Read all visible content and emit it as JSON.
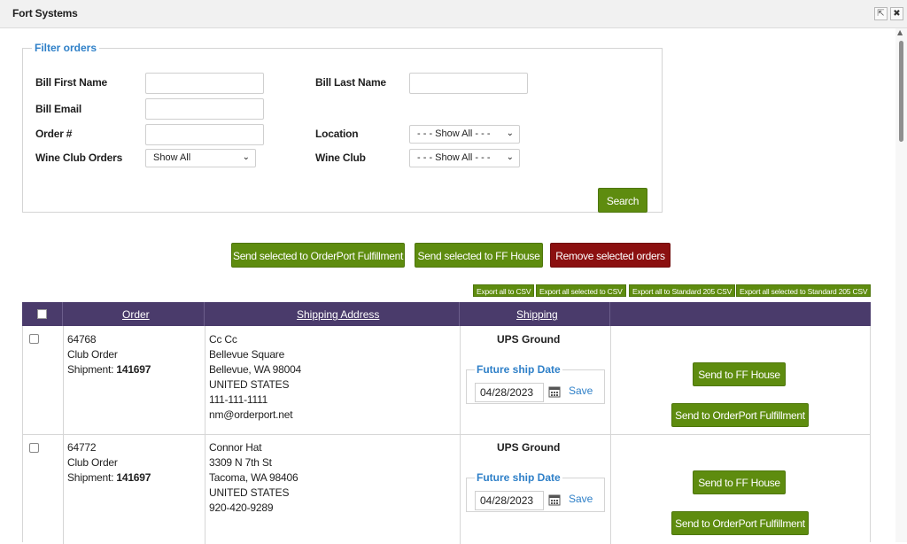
{
  "window": {
    "title": "Fort Systems",
    "popout_icon": "⇱",
    "close_icon": "✖"
  },
  "filter": {
    "legend": "Filter orders",
    "bill_first_name_label": "Bill First Name",
    "bill_last_name_label": "Bill Last Name",
    "bill_email_label": "Bill Email",
    "order_label": "Order #",
    "location_label": "Location",
    "location_value": "- - - Show All - - -",
    "wine_club_orders_label": "Wine Club Orders",
    "wine_club_orders_value": "Show All",
    "wine_club_label": "Wine Club",
    "wine_club_value": "- - - Show All - - -",
    "search_label": "Search"
  },
  "actions": {
    "send_orderport": "Send selected to OrderPort Fulfillment",
    "send_ff_house": "Send selected to FF House",
    "remove": "Remove selected orders"
  },
  "exports": [
    "Export all to CSV",
    "Export all selected to CSV",
    "Export all to Standard 205 CSV",
    "Export all selected to Standard 205 CSV"
  ],
  "table": {
    "headers": {
      "order": "Order",
      "address": "Shipping Address",
      "shipping": "Shipping"
    },
    "rows": [
      {
        "order_no": "64768",
        "order_type": "Club Order",
        "shipment_label": "Shipment: ",
        "shipment_no": "141697",
        "address": [
          "Cc Cc",
          "Bellevue Square",
          "Bellevue, WA 98004",
          "UNITED STATES",
          "111-111-1111",
          "nm@orderport.net"
        ],
        "shipping_method": "UPS Ground",
        "ship_date_legend": "Future ship Date",
        "ship_date": "04/28/2023",
        "save_label": "Save",
        "ff_house_label": "Send to FF House",
        "orderport_label": "Send to OrderPort Fulfillment"
      },
      {
        "order_no": "64772",
        "order_type": "Club Order",
        "shipment_label": "Shipment: ",
        "shipment_no": "141697",
        "address": [
          "Connor Hat",
          "3309 N 7th St",
          "Tacoma, WA 98406",
          "UNITED STATES",
          "920-420-9289"
        ],
        "shipping_method": "UPS Ground",
        "ship_date_legend": "Future ship Date",
        "ship_date": "04/28/2023",
        "save_label": "Save",
        "ff_house_label": "Send to FF House",
        "orderport_label": "Send to OrderPort Fulfillment"
      }
    ]
  }
}
